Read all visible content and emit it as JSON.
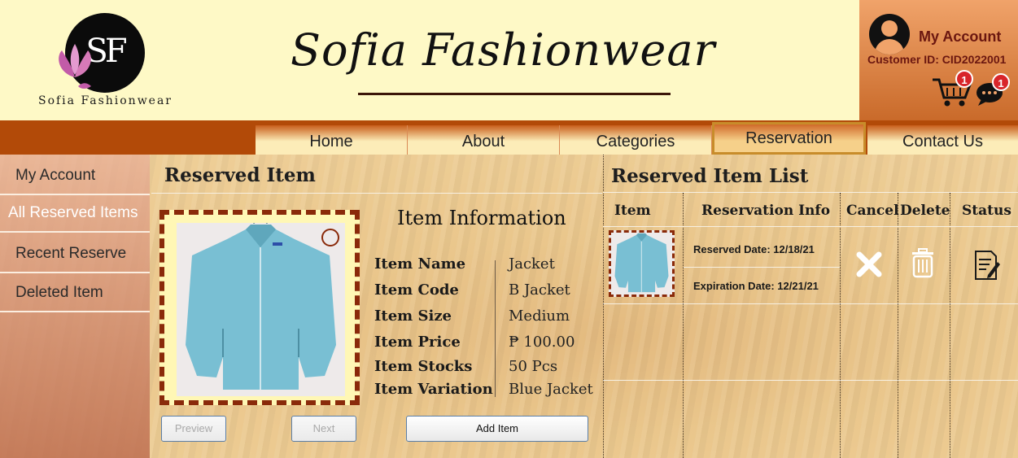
{
  "header": {
    "logo_letters": "SF",
    "logo_text": "Sofia Fashionwear",
    "brand_title": "Sofia Fashionwear",
    "account_label": "My Account",
    "customer_id": "Customer ID: CID2022001",
    "cart_count": "1",
    "message_count": "1",
    "icons": [
      "user-avatar-icon",
      "shopping-cart-icon",
      "chat-icon"
    ]
  },
  "nav": {
    "items": [
      {
        "label": "Home"
      },
      {
        "label": "About"
      },
      {
        "label": "Categories"
      },
      {
        "label": "Reservation",
        "active": true
      },
      {
        "label": "Contact Us"
      }
    ]
  },
  "sidebar": {
    "items": [
      {
        "label": "My Account"
      },
      {
        "label": "All Reserved Items",
        "active": true
      },
      {
        "label": "Recent Reserve"
      },
      {
        "label": "Deleted Item"
      }
    ]
  },
  "reserved_item": {
    "title": "Reserved Item",
    "info_title": "Item Information",
    "fields": [
      {
        "label": "Item Name",
        "value": "Jacket"
      },
      {
        "label": "Item Code",
        "value": "B Jacket"
      },
      {
        "label": "Item Size",
        "value": "Medium"
      },
      {
        "label": "Item Price",
        "value": "₱ 100.00"
      },
      {
        "label": "Item Stocks",
        "value": "50 Pcs"
      },
      {
        "label": "Item Variation",
        "value": "Blue Jacket"
      }
    ],
    "buttons": {
      "preview": "Preview",
      "next": "Next",
      "add": "Add Item"
    }
  },
  "reserved_list": {
    "title": "Reserved Item List",
    "columns": [
      "Item",
      "Reservation Info",
      "Cancel",
      "Delete",
      "Status"
    ],
    "rows": [
      {
        "reserved_date": "Reserved Date: 12/18/21",
        "expiration_date": "Expiration Date: 12/21/21"
      }
    ]
  },
  "colors": {
    "header_bg": "#fef9c6",
    "nav_bg": "#b24a08",
    "accent": "#8a2a0a",
    "badge": "#d8252a"
  }
}
